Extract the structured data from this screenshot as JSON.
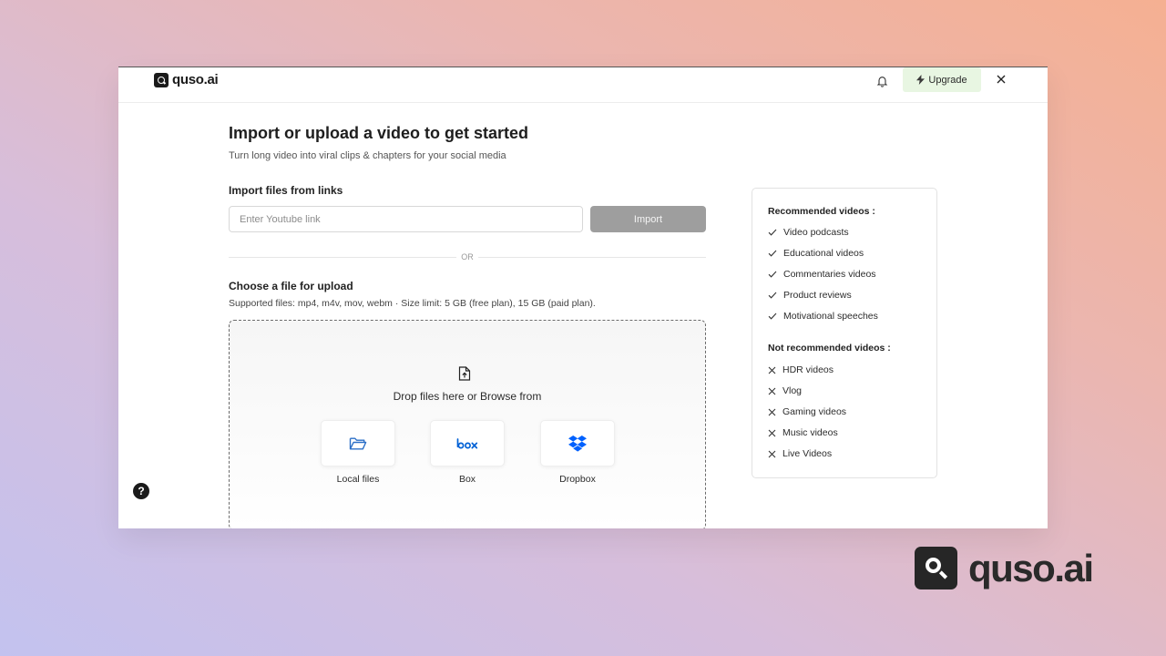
{
  "brand": {
    "name": "quso.ai"
  },
  "header": {
    "upgrade_label": "Upgrade"
  },
  "page": {
    "title": "Import or upload a video to get started",
    "subtitle": "Turn long video into viral clips & chapters for your social media"
  },
  "import": {
    "title": "Import files from links",
    "placeholder": "Enter Youtube link",
    "value": "",
    "button_label": "Import"
  },
  "or_label": "OR",
  "upload": {
    "title": "Choose a file for upload",
    "supported": "Supported files: mp4, m4v, mov, webm  ·  Size limit: 5 GB (free plan), 15 GB (paid plan).",
    "drop_text": "Drop files here or Browse from",
    "sources": [
      {
        "label": "Local files",
        "icon": "folder-icon"
      },
      {
        "label": "Box",
        "icon": "box-logo-icon"
      },
      {
        "label": "Dropbox",
        "icon": "dropbox-icon"
      }
    ]
  },
  "recommendations": {
    "recommended_title": "Recommended videos :",
    "recommended": [
      "Video podcasts",
      "Educational videos",
      "Commentaries videos",
      "Product reviews",
      "Motivational speeches"
    ],
    "not_recommended_title": "Not recommended videos :",
    "not_recommended": [
      "HDR videos",
      "Vlog",
      "Gaming videos",
      "Music videos",
      "Live Videos"
    ]
  },
  "help_label": "?",
  "colors": {
    "accent_upgrade_bg": "#e8f6e2",
    "import_button_bg": "#9e9e9e",
    "box_blue": "#0061d5",
    "dropbox_blue": "#0061fe",
    "folder_blue": "#2b6fc7"
  }
}
